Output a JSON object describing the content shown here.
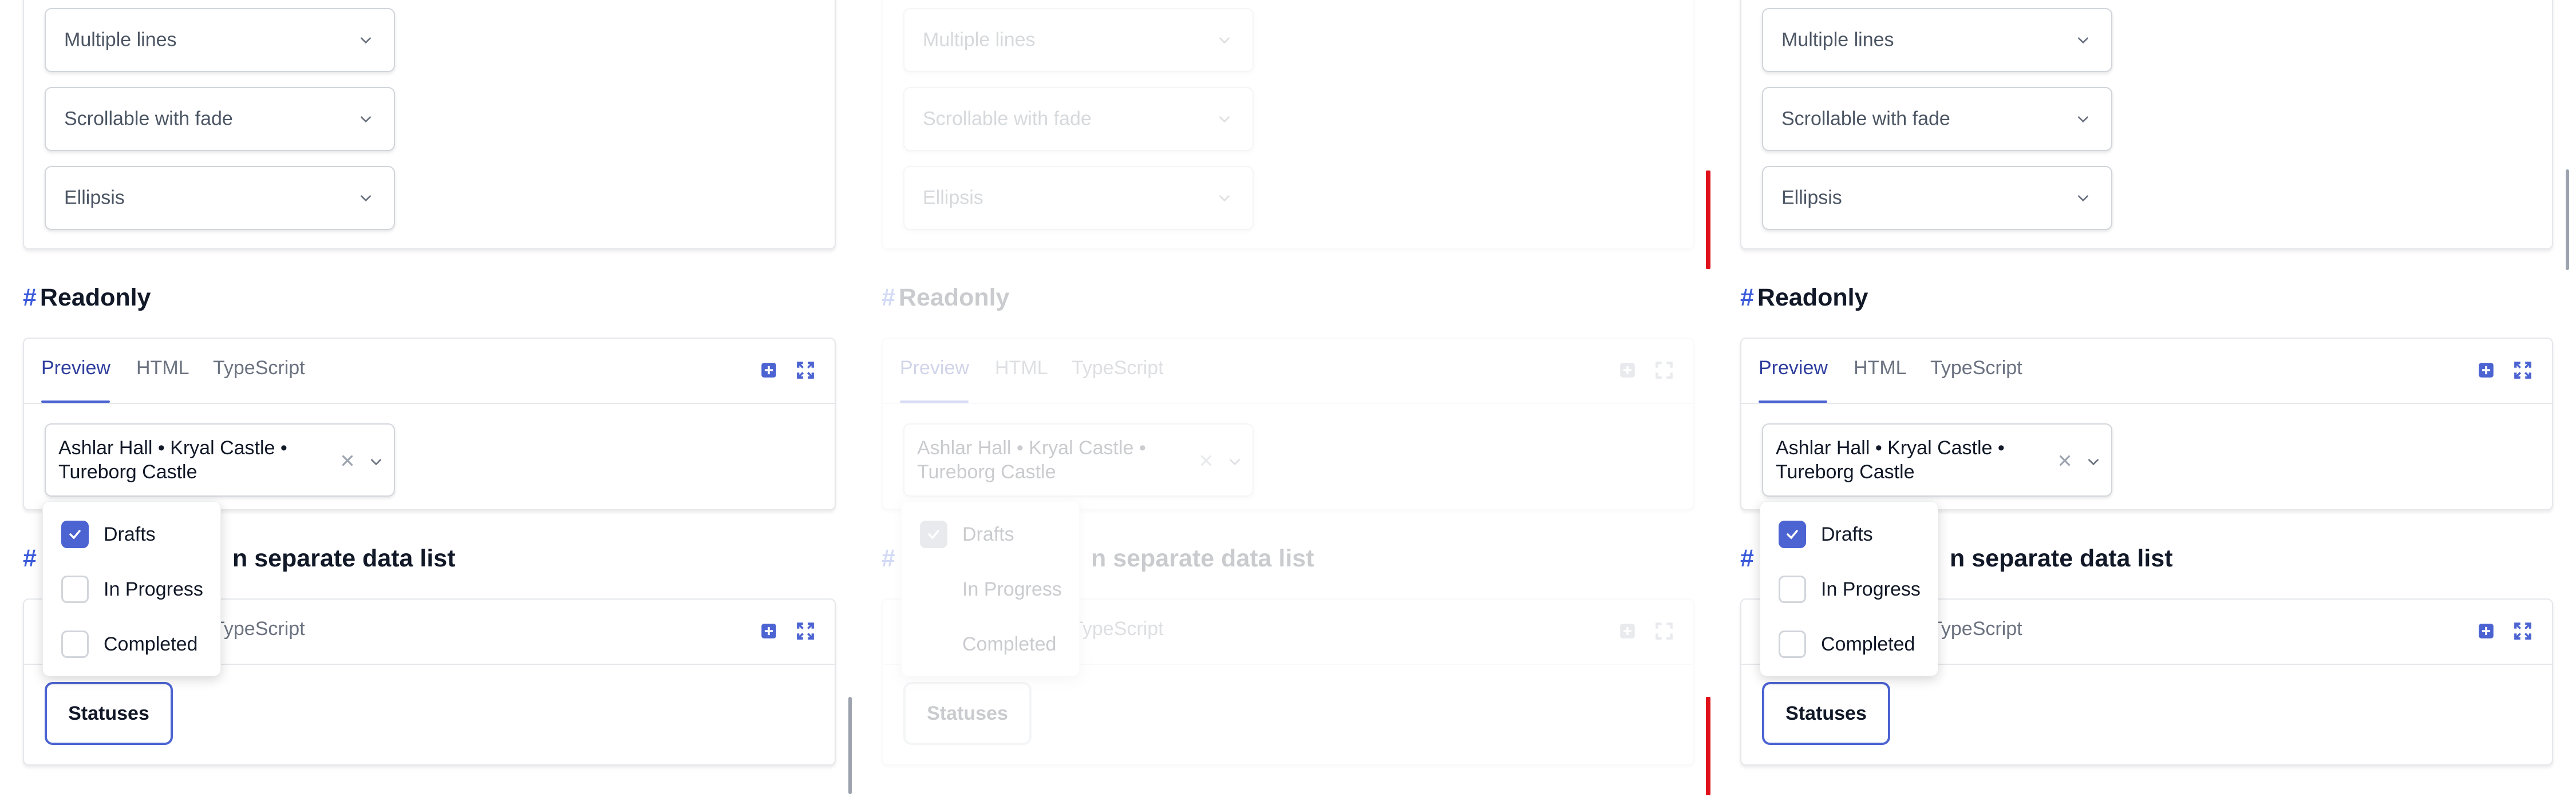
{
  "sections": {
    "top_selects": [
      "Multiple lines",
      "Scrollable with fade",
      "Ellipsis"
    ],
    "readonly": {
      "hash": "#",
      "title": "Readonly",
      "tabs": [
        "Preview",
        "HTML",
        "TypeScript"
      ],
      "selected_value": "Ashlar Hall  •  Kryal Castle  •  Tureborg Castle"
    },
    "datalist": {
      "hash": "#",
      "title_visible": "n separate data list",
      "tab_visible": "TypeScript",
      "button_label": "Statuses",
      "dropdown_items": [
        {
          "label": "Drafts",
          "checked": true
        },
        {
          "label": "In Progress",
          "checked": false
        },
        {
          "label": "Completed",
          "checked": false
        }
      ]
    }
  },
  "icons": {
    "chevron": "chevron-down-icon",
    "clear": "close-icon",
    "open_in_new": "open-in-editor-icon",
    "fullscreen": "expand-icon",
    "check": "check-icon"
  },
  "colors": {
    "accent": "#4c63d2",
    "hash": "#3b5bdb",
    "marker": "#e0101a"
  }
}
